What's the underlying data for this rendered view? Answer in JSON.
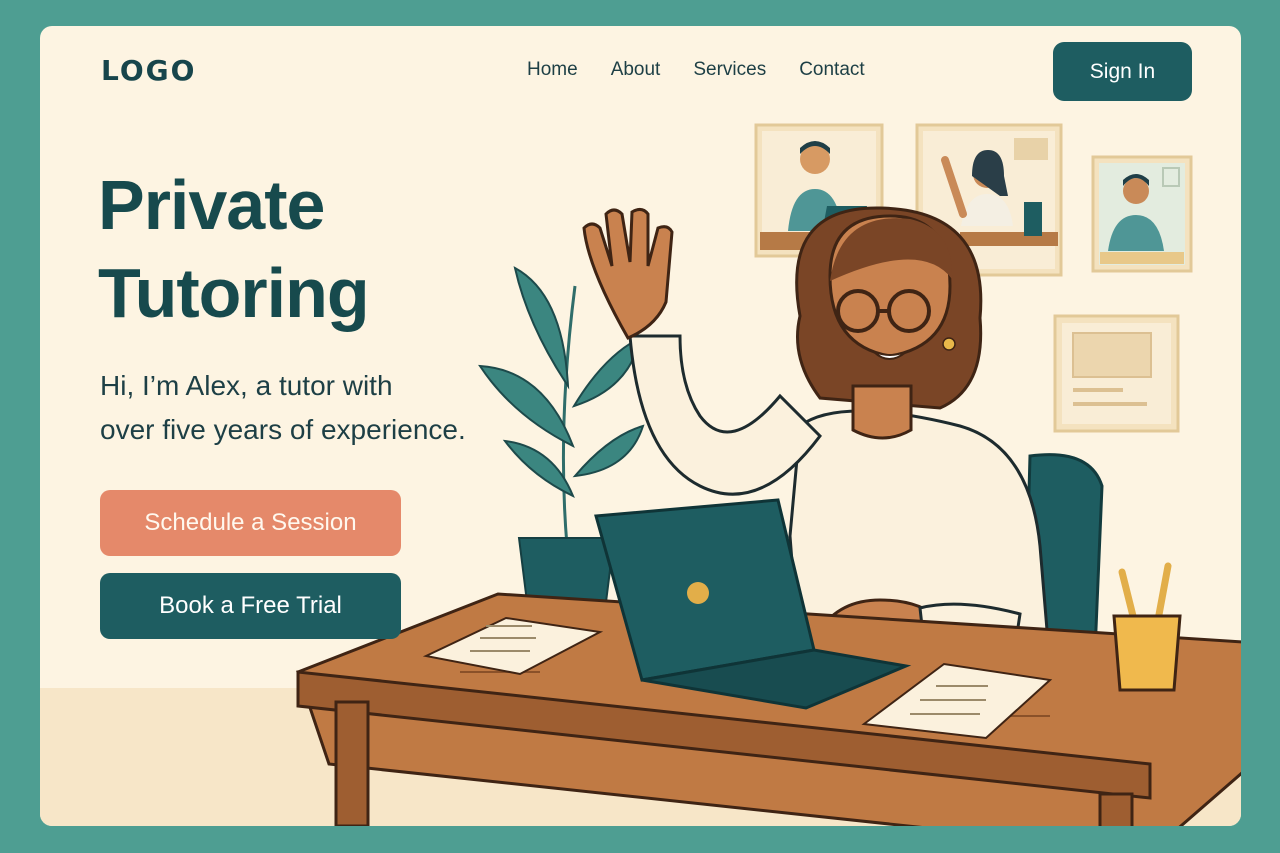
{
  "header": {
    "logo": "LOGO",
    "nav": [
      "Home",
      "About",
      "Services",
      "Contact"
    ],
    "sign_in_label": "Sign In"
  },
  "hero": {
    "title_line1": "Private",
    "title_line2": "Tutoring",
    "subtitle_line1": "Hi, I’m Alex, a tutor with",
    "subtitle_line2": "over five years of experience.",
    "primary_cta": "Schedule a Session",
    "secondary_cta": "Book a Free Trial"
  },
  "colors": {
    "page_border": "#4e9e92",
    "background": "#fdf4e2",
    "brand_dark": "#1e5d61",
    "accent_coral": "#e5896a",
    "text_dark": "#174a4d"
  }
}
